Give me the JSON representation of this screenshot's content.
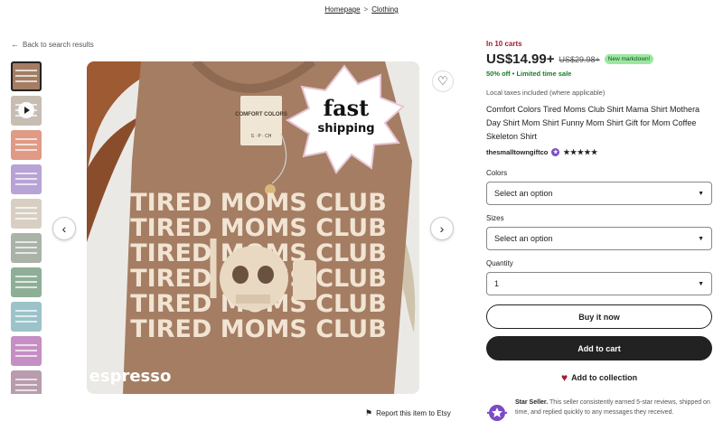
{
  "breadcrumb": {
    "home": "Homepage",
    "separator": ">",
    "category": "Clothing"
  },
  "back_link": {
    "label": "Back to search results"
  },
  "thumbnails": [
    {
      "color": "#a47d63",
      "active": true,
      "video": false
    },
    {
      "color": "#c7bdb3",
      "active": false,
      "video": true
    },
    {
      "color": "#e09a85",
      "active": false,
      "video": false
    },
    {
      "color": "#b7a3d6",
      "active": false,
      "video": false
    },
    {
      "color": "#d8cfc2",
      "active": false,
      "video": false
    },
    {
      "color": "#aab3a7",
      "active": false,
      "video": false
    },
    {
      "color": "#8fae97",
      "active": false,
      "video": false
    },
    {
      "color": "#9bc3c9",
      "active": false,
      "video": false
    },
    {
      "color": "#c58fc3",
      "active": false,
      "video": false
    },
    {
      "color": "#b99cae",
      "active": false,
      "video": false
    }
  ],
  "image": {
    "shirt_text": "TIRED MOMS CLUB",
    "sticker_line1": "fast",
    "sticker_line2": "shipping",
    "brand": "espresso",
    "tag_text": "COMFORT COLORS",
    "tag_size": "S · P · CH"
  },
  "report": {
    "label": "Report this item to Etsy"
  },
  "product": {
    "carts": "In 10 carts",
    "price": "US$14.99+",
    "old_price": "US$29.98+",
    "markdown_badge": "New markdown!",
    "discount": "50% off • Limited time sale",
    "taxes": "Local taxes included (where applicable)",
    "title": "Comfort Colors Tired Moms Club Shirt Mama Shirt Mothera Day Shirt Mom Shirt Funny Mom Shirt Gift for Mom Coffee Skeleton Shirt",
    "shop_name": "thesmalltowngiftco",
    "stars": "★★★★★"
  },
  "options": {
    "colors_label": "Colors",
    "colors_value": "Select an option",
    "sizes_label": "Sizes",
    "sizes_value": "Select an option",
    "quantity_label": "Quantity",
    "quantity_value": "1"
  },
  "actions": {
    "buy_now": "Buy it now",
    "add_to_cart": "Add to cart",
    "add_to_collection": "Add to collection"
  },
  "star_seller": {
    "title": "Star Seller.",
    "text": "This seller consistently earned 5-star reviews, shipped on time, and replied quickly to any messages they received."
  },
  "colors": {
    "accent_red": "#a61a2e",
    "discount_green": "#1a7d28",
    "badge_green": "#9ae89f",
    "shirt_brown": "#a47d63",
    "shirt_print": "#f1e4d3",
    "star_seller_purple": "#7b4bc7"
  }
}
